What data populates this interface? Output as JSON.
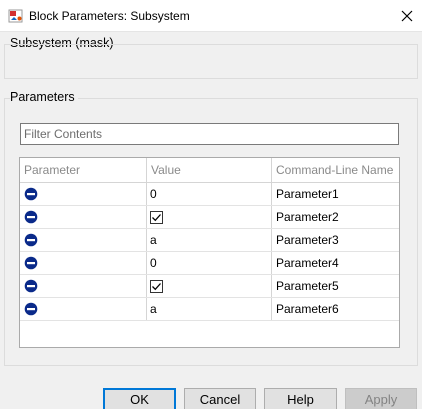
{
  "window": {
    "title": "Block Parameters: Subsystem",
    "icons": {
      "app": "simulink-block-icon",
      "close": "close-icon"
    }
  },
  "mask": {
    "heading": "Subsystem (mask)"
  },
  "parameters": {
    "heading": "Parameters",
    "filter_placeholder": "Filter Contents",
    "filter_value": "",
    "columns": [
      "Parameter",
      "Value",
      "Command-Line Name"
    ],
    "rows": [
      {
        "icon": "minus-circle-icon",
        "parameter": "",
        "value": "0",
        "value_type": "text",
        "name": "Parameter1"
      },
      {
        "icon": "minus-circle-icon",
        "parameter": "",
        "value": "",
        "value_type": "checkbox",
        "checked": true,
        "name": "Parameter2"
      },
      {
        "icon": "minus-circle-icon",
        "parameter": "",
        "value": "a",
        "value_type": "text",
        "name": "Parameter3"
      },
      {
        "icon": "minus-circle-icon",
        "parameter": "",
        "value": "0",
        "value_type": "text",
        "name": "Parameter4"
      },
      {
        "icon": "minus-circle-icon",
        "parameter": "",
        "value": "",
        "value_type": "checkbox",
        "checked": true,
        "name": "Parameter5"
      },
      {
        "icon": "minus-circle-icon",
        "parameter": "",
        "value": "a",
        "value_type": "text",
        "name": "Parameter6"
      }
    ]
  },
  "buttons": {
    "ok": "OK",
    "cancel": "Cancel",
    "help": "Help",
    "apply": "Apply"
  },
  "colors": {
    "accent": "#0078d7",
    "icon_fill": "#0a2a8a"
  }
}
